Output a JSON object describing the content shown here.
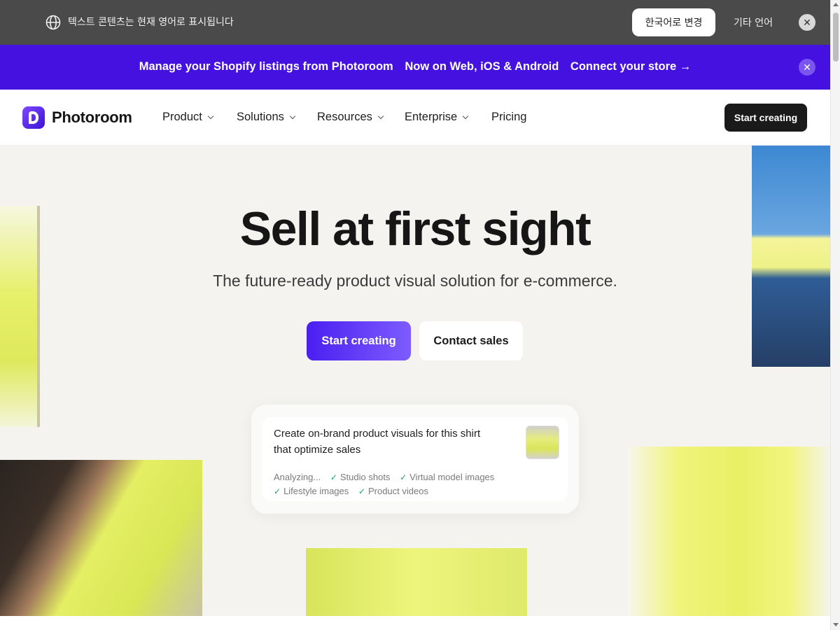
{
  "translate_bar": {
    "icon": "globe-icon",
    "message": "텍스트 콘텐츠는 현재 영어로 표시됩니다",
    "change_button": "한국어로 변경",
    "other_languages": "기타 언어",
    "close_icon": "close-icon"
  },
  "promo_bar": {
    "background": "#4411e0",
    "part1": "Manage your Shopify listings from Photoroom",
    "part2": "Now on Web, iOS & Android",
    "link": "Connect your store →",
    "close_icon": "close-icon"
  },
  "nav": {
    "brand": "Photoroom",
    "items": [
      {
        "label": "Product",
        "has_dropdown": true
      },
      {
        "label": "Solutions",
        "has_dropdown": true
      },
      {
        "label": "Resources",
        "has_dropdown": true
      },
      {
        "label": "Enterprise",
        "has_dropdown": true
      },
      {
        "label": "Pricing",
        "has_dropdown": false
      }
    ],
    "cta": "Start creating"
  },
  "hero": {
    "title": "Sell at first sight",
    "subtitle": "The future-ready product visual solution for e-commerce.",
    "primary_button": "Start creating",
    "secondary_button": "Contact sales",
    "accent": "#4a1ff0"
  },
  "prompt_card": {
    "prompt": "Create on-brand product visuals for this shirt that optimize sales",
    "status": "Analyzing...",
    "tags": [
      "Studio shots",
      "Virtual model images",
      "Lifestyle images",
      "Product videos"
    ]
  }
}
